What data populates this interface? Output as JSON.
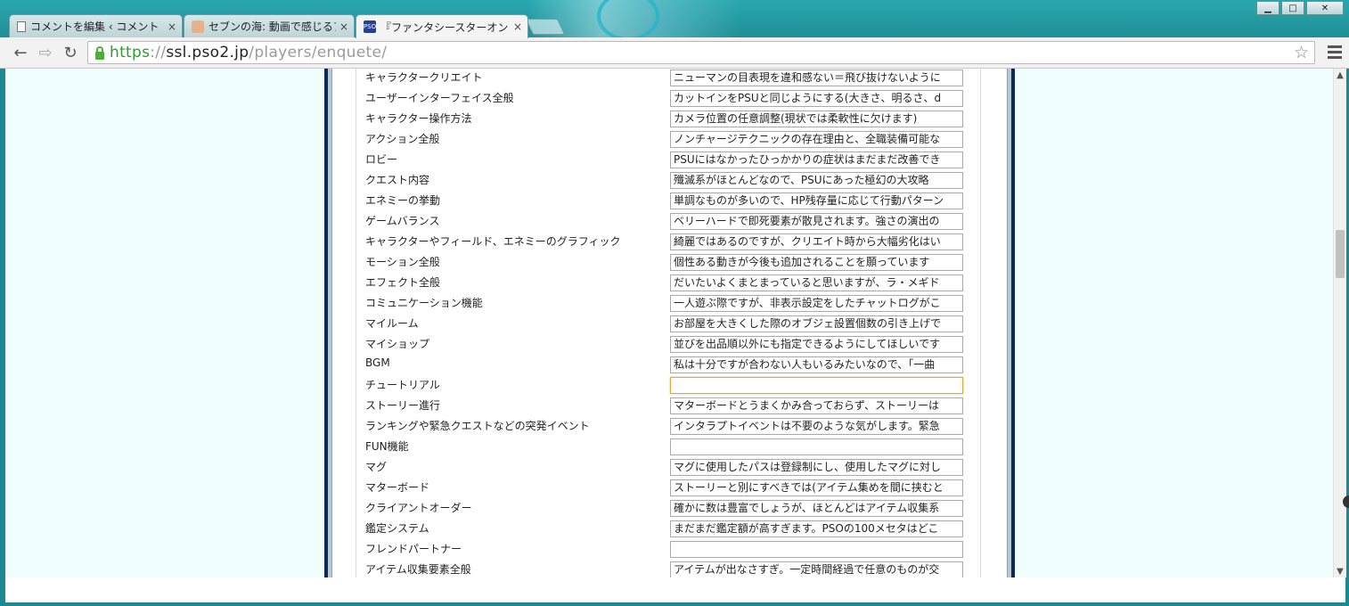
{
  "browser": {
    "tabs": [
      {
        "title": "コメントを編集 ‹ コメント",
        "icon": "document-icon",
        "active": false
      },
      {
        "title": "セブンの海: 動画で感じるア",
        "icon": "anime-favicon-icon",
        "active": false
      },
      {
        "title": "『ファンタシースターオンラ",
        "icon": "pso2-favicon-icon",
        "active": true
      }
    ],
    "tab_close": "×",
    "favicon_pso2_text": "PSO",
    "address": {
      "scheme": "https",
      "separator": "://",
      "host": "ssl.pso2.jp",
      "path": "/players/enquete/"
    },
    "window_controls": {
      "minimize": "▁",
      "maximize": "□",
      "close": "✕"
    },
    "nav": {
      "back": "←",
      "forward": "⇨",
      "reload": "↻"
    },
    "star": "☆",
    "scroll_up": "▲",
    "scroll_down": "▼"
  },
  "form_rows": [
    {
      "label": "キャラクタークリエイト",
      "value": "ニューマンの目表現を違和感ない＝飛び抜けないように"
    },
    {
      "label": "ユーザーインターフェイス全般",
      "value": "カットインをPSUと同じようにする(大きさ、明るさ、d"
    },
    {
      "label": "キャラクター操作方法",
      "value": "カメラ位置の任意調整(現状では柔軟性に欠けます)"
    },
    {
      "label": "アクション全般",
      "value": "ノンチャージテクニックの存在理由と、全職装備可能な"
    },
    {
      "label": "ロビー",
      "value": "PSUにはなかったひっかかりの症状はまだまだ改善でき"
    },
    {
      "label": "クエスト内容",
      "value": "殲滅系がほとんどなので、PSUにあった極幻の大攻略"
    },
    {
      "label": "エネミーの挙動",
      "value": "単調なものが多いので、HP残存量に応じて行動パターン"
    },
    {
      "label": "ゲームバランス",
      "value": "ベリーハードで即死要素が散見されます。強さの演出の"
    },
    {
      "label": "キャラクターやフィールド、エネミーのグラフィック",
      "value": "綺麗ではあるのですが、クリエイト時から大幅劣化はい"
    },
    {
      "label": "モーション全般",
      "value": "個性ある動きが今後も追加されることを願っています"
    },
    {
      "label": "エフェクト全般",
      "value": "だいたいよくまとまっていると思いますが、ラ・メギド"
    },
    {
      "label": "コミュニケーション機能",
      "value": "一人遊ぶ際ですが、非表示設定をしたチャットログがこ"
    },
    {
      "label": "マイルーム",
      "value": "お部屋を大きくした際のオブジェ設置個数の引き上げで"
    },
    {
      "label": "マイショップ",
      "value": "並びを出品順以外にも指定できるようにしてほしいです"
    },
    {
      "label": "BGM",
      "value": "私は十分ですが合わない人もいるみたいなので、「一曲"
    },
    {
      "label": "チュートリアル",
      "value": ""
    },
    {
      "label": "ストーリー進行",
      "value": "マターボードとうまくかみ合っておらず、ストーリーは"
    },
    {
      "label": "ランキングや緊急クエストなどの突発イベント",
      "value": "インタラプトイベントは不要のような気がします。緊急"
    },
    {
      "label": "FUN機能",
      "value": ""
    },
    {
      "label": "マグ",
      "value": "マグに使用したパスは登録制にし、使用したマグに対し"
    },
    {
      "label": "マターボード",
      "value": "ストーリーと別にすべきでは(アイテム集めを間に挟むと"
    },
    {
      "label": "クライアントオーダー",
      "value": "確かに数は豊富でしょうが、ほとんどはアイテム収集系"
    },
    {
      "label": "鑑定システム",
      "value": "まだまだ鑑定額が高すぎます。PSOの100メセタはどこ"
    },
    {
      "label": "フレンドパートナー",
      "value": ""
    },
    {
      "label": "アイテム収集要素全般",
      "value": "アイテムが出なさすぎ。一定時間経過で任意のものが交"
    }
  ],
  "focused_field_index": 15,
  "colors": {
    "chrome_frame": "#1c8891",
    "page_background": "#f0feff",
    "page_border": "#0b2a55",
    "focus_outline": "#e8a73a",
    "secure_green": "#2e9b2e"
  }
}
